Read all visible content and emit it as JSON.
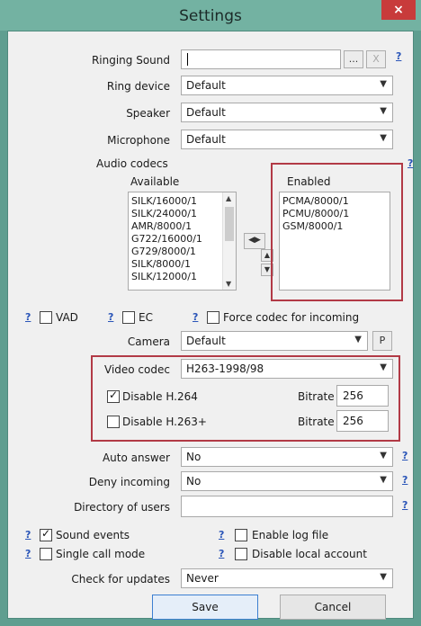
{
  "window": {
    "title": "Settings",
    "close_glyph": "×"
  },
  "help_glyph": "?",
  "ringing_sound": {
    "label": "Ringing Sound",
    "value": "",
    "browse": "...",
    "clear": "X"
  },
  "ring_device": {
    "label": "Ring device",
    "value": "Default"
  },
  "speaker": {
    "label": "Speaker",
    "value": "Default"
  },
  "microphone": {
    "label": "Microphone",
    "value": "Default"
  },
  "codecs": {
    "label": "Audio codecs",
    "available_label": "Available",
    "enabled_label": "Enabled",
    "available": [
      "SILK/16000/1",
      "SILK/24000/1",
      "AMR/8000/1",
      "G722/16000/1",
      "G729/8000/1",
      "SILK/8000/1",
      "SILK/12000/1"
    ],
    "enabled": [
      "PCMA/8000/1",
      "PCMU/8000/1",
      "GSM/8000/1"
    ]
  },
  "vad": {
    "label": "VAD",
    "checked": false
  },
  "ec": {
    "label": "EC",
    "checked": false
  },
  "force_codec": {
    "label": "Force codec for incoming",
    "checked": false
  },
  "camera": {
    "label": "Camera",
    "value": "Default",
    "p_button": "P"
  },
  "video": {
    "label": "Video codec",
    "value": "H263-1998/98",
    "disable_h264": {
      "label": "Disable H.264",
      "checked": true,
      "bitrate_label": "Bitrate",
      "bitrate": "256"
    },
    "disable_h263p": {
      "label": "Disable H.263+",
      "checked": false,
      "bitrate_label": "Bitrate",
      "bitrate": "256"
    }
  },
  "auto_answer": {
    "label": "Auto answer",
    "value": "No"
  },
  "deny_incoming": {
    "label": "Deny incoming",
    "value": "No"
  },
  "directory": {
    "label": "Directory of users",
    "value": ""
  },
  "sound_events": {
    "label": "Sound events",
    "checked": true
  },
  "enable_log": {
    "label": "Enable log file",
    "checked": false
  },
  "single_call": {
    "label": "Single call mode",
    "checked": false
  },
  "disable_local": {
    "label": "Disable local account",
    "checked": false
  },
  "check_updates": {
    "label": "Check for updates",
    "value": "Never"
  },
  "buttons": {
    "save": "Save",
    "cancel": "Cancel"
  },
  "colors": {
    "title_bg": "#73b2a2",
    "close_bg": "#c83b3b",
    "highlight": "#b23a46",
    "help": "#2a55b8"
  }
}
